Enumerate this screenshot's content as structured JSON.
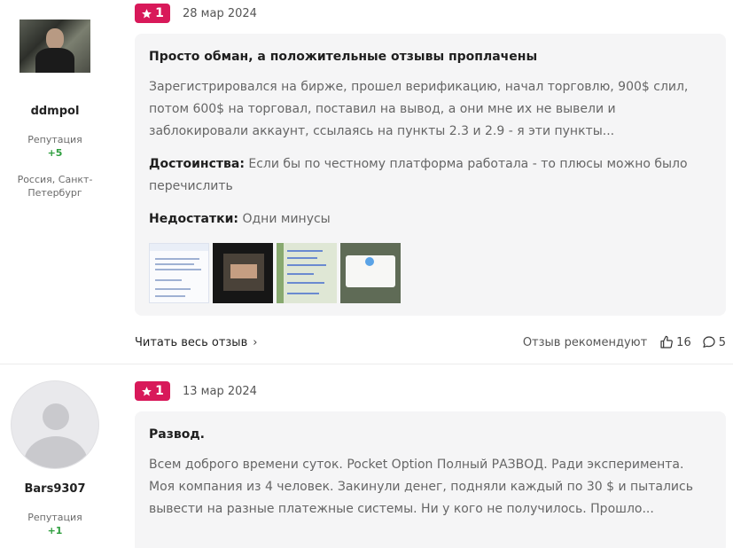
{
  "reviews": [
    {
      "author": {
        "name": "ddmpol",
        "reputation_label": "Репутация",
        "reputation": "+5",
        "location": "Россия, Санкт-Петербург"
      },
      "rating": "1",
      "date": "28 мар 2024",
      "title": "Просто обман, а положительные отзывы проплачены",
      "text": "Зарегистрировался на бирже, прошел верификацию, начал торговлю, 900$ слил, потом 600$ на торговал, поставил на вывод, а они мне их не вывели и заблокировали аккаунт, ссылаясь на пункты 2.3 и 2.9 - я эти пункты...",
      "pros_label": "Достоинства:",
      "pros": "Если бы по честному платформа работала - то плюсы можно было перечислить",
      "cons_label": "Недостатки:",
      "cons": "Одни минусы",
      "read_more": "Читать весь отзыв",
      "recommend_label": "Отзыв рекомендуют",
      "likes": "16",
      "comments": "5"
    },
    {
      "author": {
        "name": "Bars9307",
        "reputation_label": "Репутация",
        "reputation": "+1"
      },
      "rating": "1",
      "date": "13 мар 2024",
      "title": "Развод.",
      "text": "Всем доброго времени суток. Pocket Option Полный РАЗВОД. Ради эксперимента. Моя компания из 4 человек. Закинули денег, подняли каждый по 30 $ и пытались вывести на разные платежные системы. Ни у кого не получилось. Прошло..."
    }
  ],
  "icons": {
    "rating": "star-icon",
    "read_more": "chevron-right-icon",
    "like": "thumbs-up-icon",
    "comment": "comment-icon"
  },
  "colors": {
    "rating_badge": "#d8195a",
    "reputation": "#2e9e3e",
    "card_bg": "#f5f5f6"
  }
}
